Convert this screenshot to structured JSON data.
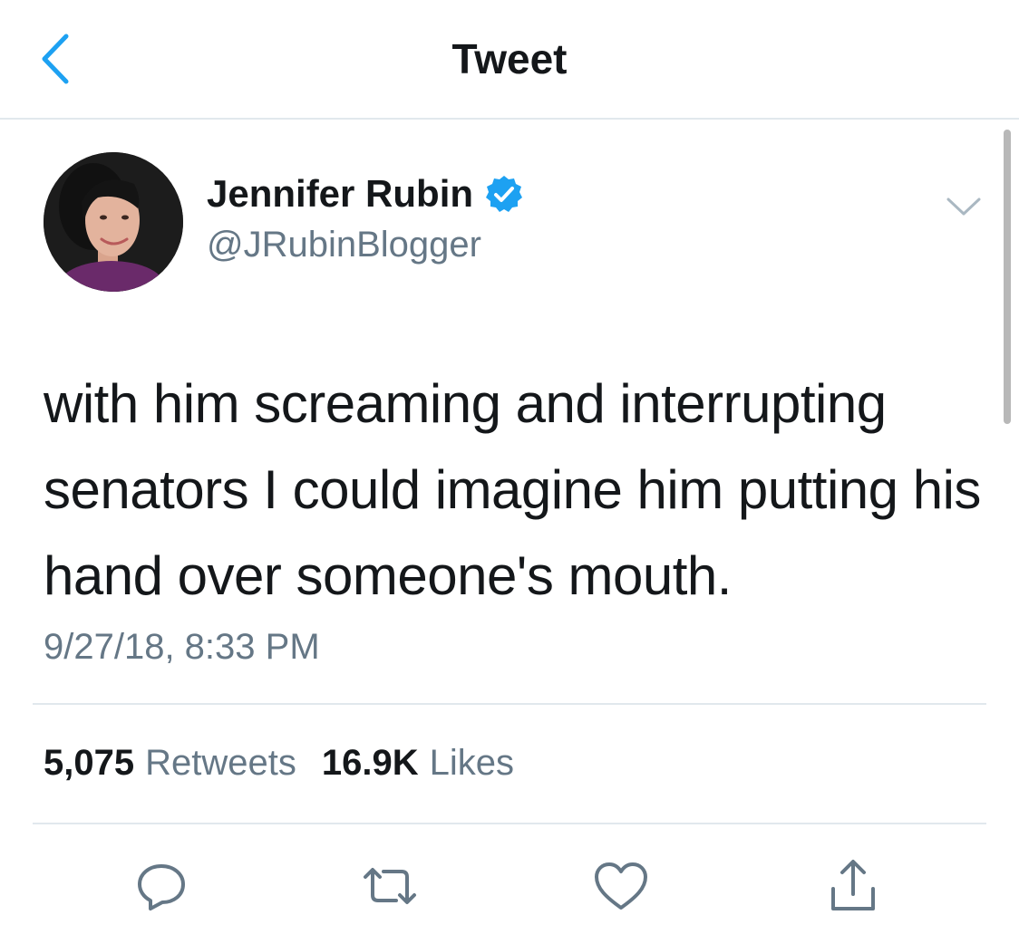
{
  "header": {
    "title": "Tweet",
    "back_icon": "chevron-left-icon"
  },
  "author": {
    "name": "Jennifer Rubin",
    "handle": "@JRubinBlogger",
    "verified": true,
    "verified_icon": "verified-badge-icon"
  },
  "tweet": {
    "text": "with him screaming and interrupting senators I could imagine him putting his hand over someone's mouth.",
    "timestamp": "9/27/18, 8:33 PM"
  },
  "stats": {
    "retweets_count": "5,075",
    "retweets_label": "Retweets",
    "likes_count": "16.9K",
    "likes_label": "Likes"
  },
  "actions": [
    {
      "name": "reply",
      "icon": "reply-icon"
    },
    {
      "name": "retweet",
      "icon": "retweet-icon"
    },
    {
      "name": "like",
      "icon": "heart-icon"
    },
    {
      "name": "share",
      "icon": "share-icon"
    }
  ],
  "colors": {
    "accent": "#1da1f2",
    "primary_text": "#14171a",
    "secondary_text": "#657786",
    "divider": "#e1e8ed"
  }
}
